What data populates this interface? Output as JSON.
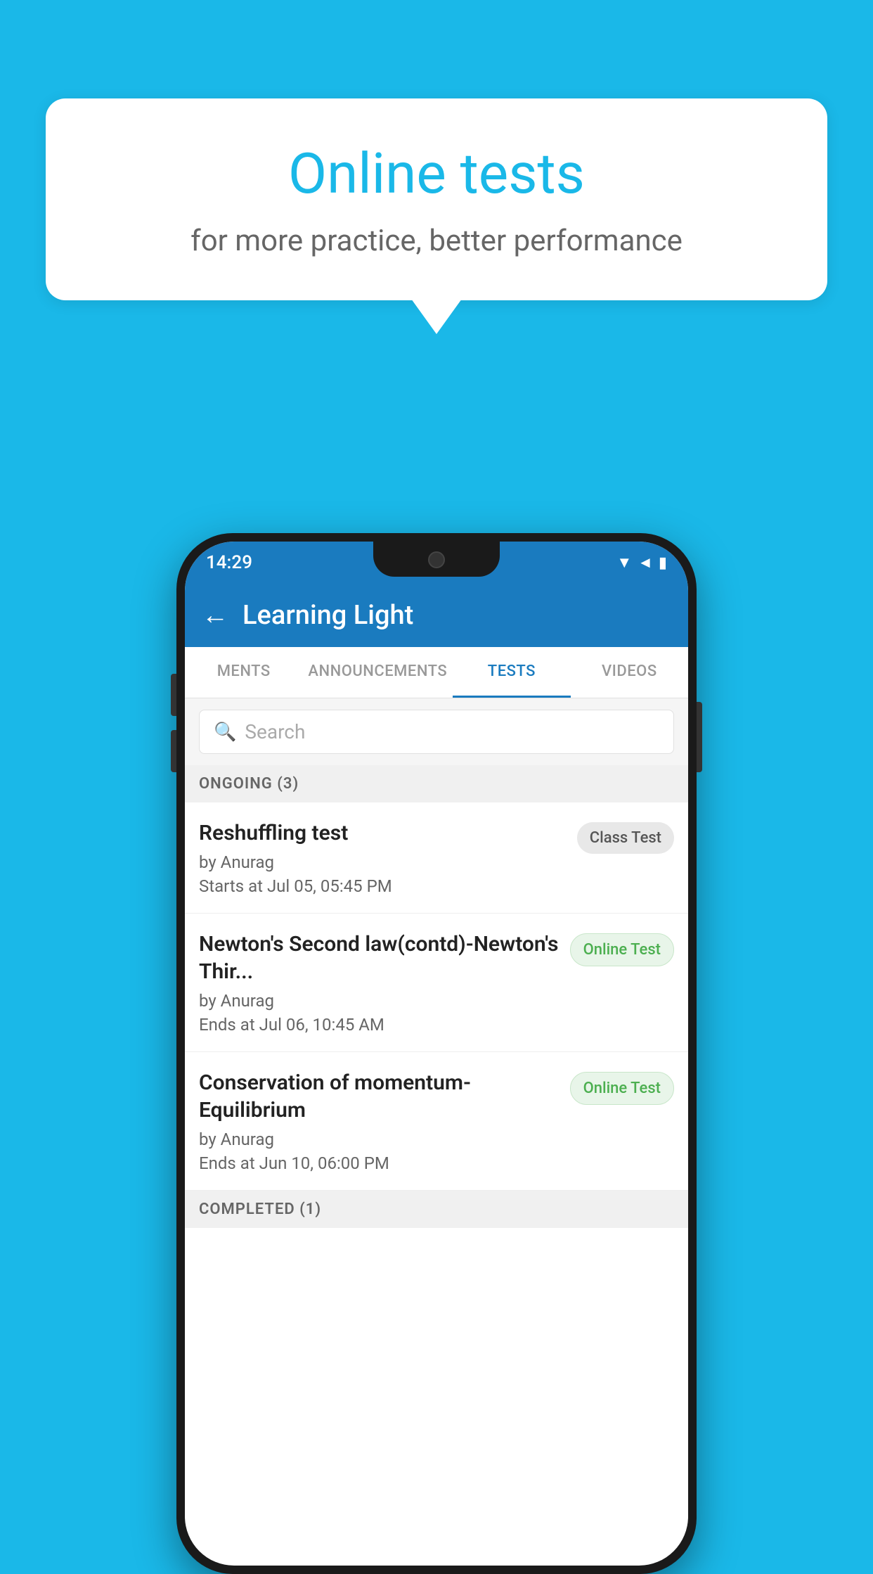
{
  "background_color": "#1ab8e8",
  "speech_bubble": {
    "title": "Online tests",
    "subtitle": "for more practice, better performance"
  },
  "phone": {
    "status_bar": {
      "time": "14:29",
      "icons": [
        "wifi",
        "signal",
        "battery"
      ]
    },
    "app_bar": {
      "back_label": "←",
      "title": "Learning Light"
    },
    "tabs": [
      {
        "label": "MENTS",
        "active": false
      },
      {
        "label": "ANNOUNCEMENTS",
        "active": false
      },
      {
        "label": "TESTS",
        "active": true
      },
      {
        "label": "VIDEOS",
        "active": false
      }
    ],
    "search": {
      "placeholder": "Search"
    },
    "ongoing_section": {
      "label": "ONGOING (3)"
    },
    "test_items": [
      {
        "title": "Reshuffling test",
        "author": "by Anurag",
        "time_label": "Starts at",
        "time": "Jul 05, 05:45 PM",
        "badge": "Class Test",
        "badge_type": "class"
      },
      {
        "title": "Newton's Second law(contd)-Newton's Thir...",
        "author": "by Anurag",
        "time_label": "Ends at",
        "time": "Jul 06, 10:45 AM",
        "badge": "Online Test",
        "badge_type": "online"
      },
      {
        "title": "Conservation of momentum-Equilibrium",
        "author": "by Anurag",
        "time_label": "Ends at",
        "time": "Jun 10, 06:00 PM",
        "badge": "Online Test",
        "badge_type": "online"
      }
    ],
    "completed_section": {
      "label": "COMPLETED (1)"
    }
  }
}
